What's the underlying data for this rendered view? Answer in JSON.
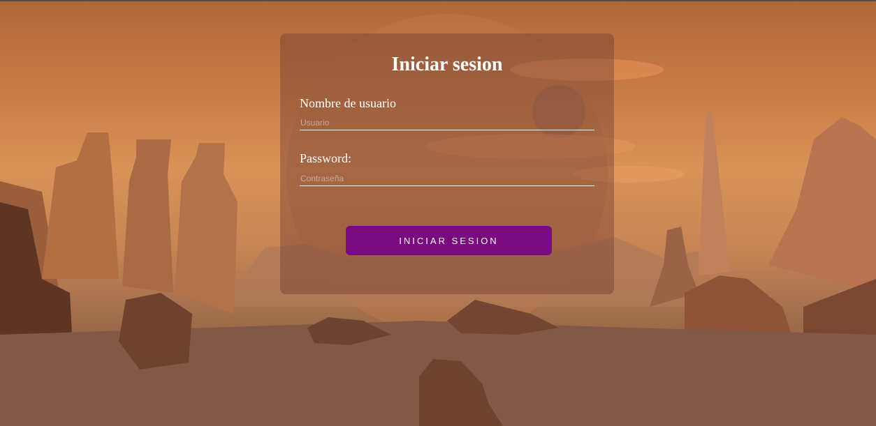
{
  "login": {
    "title": "Iniciar sesion",
    "username_label": "Nombre de usuario",
    "username_placeholder": "Usuario",
    "password_label": "Password:",
    "password_placeholder": "Contraseña",
    "submit_label": "INICIAR SESION"
  },
  "colors": {
    "button_background": "#7a0a80",
    "text": "#ffffff"
  }
}
